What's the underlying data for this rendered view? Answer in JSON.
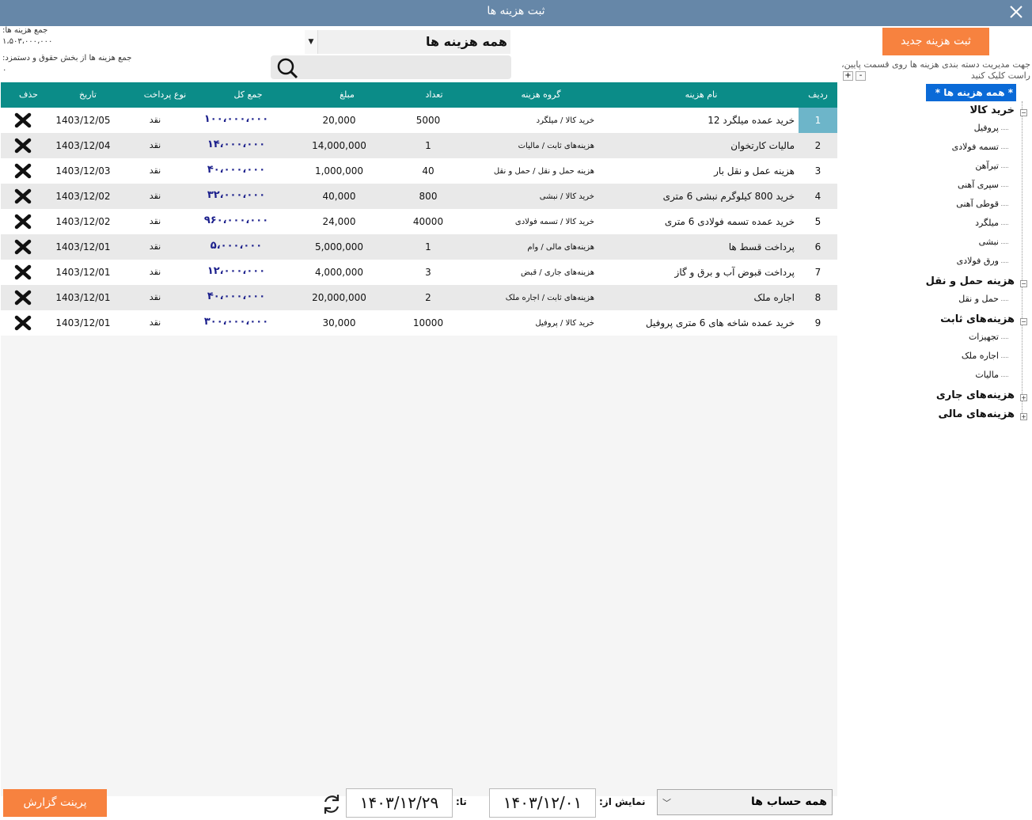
{
  "window": {
    "title": "ثبت هزینه ها"
  },
  "totals": {
    "label1": "جمع هزینه ها:",
    "value1": "۱،۵۰۳،۰۰۰،۰۰۰",
    "label2": "جمع هزینه ها از بخش حقوق و دستمزد:",
    "value2": "۰"
  },
  "filter": {
    "selected": "همه هزینه ها"
  },
  "search": {
    "placeholder": "",
    "value": ""
  },
  "table": {
    "headers": {
      "idx": "ردیف",
      "name": "نام هزینه",
      "group": "گروه هزینه",
      "qty": "تعداد",
      "amount": "مبلغ",
      "total": "جمع کل",
      "type": "نوع پرداخت",
      "date": "تاریخ",
      "del": "حذف"
    },
    "rows": [
      {
        "idx": "1",
        "name": "خرید عمده میلگرد 12",
        "group": "خرید کالا / میلگرد",
        "qty": "5000",
        "amount": "20,000",
        "total": "۱۰۰،۰۰۰،۰۰۰",
        "type": "نقد",
        "date": "1403/12/05"
      },
      {
        "idx": "2",
        "name": "مالیات کارتخوان",
        "group": "هزینه‌های ثابت / مالیات",
        "qty": "1",
        "amount": "14,000,000",
        "total": "۱۴،۰۰۰،۰۰۰",
        "type": "نقد",
        "date": "1403/12/04"
      },
      {
        "idx": "3",
        "name": "هزینه عمل و نقل بار",
        "group": "هزینه حمل و نقل / حمل و نقل",
        "qty": "40",
        "amount": "1,000,000",
        "total": "۴۰،۰۰۰،۰۰۰",
        "type": "نقد",
        "date": "1403/12/03"
      },
      {
        "idx": "4",
        "name": "خرید 800 کیلوگرم نبشی 6 متری",
        "group": "خرید کالا / نبشی",
        "qty": "800",
        "amount": "40,000",
        "total": "۳۲،۰۰۰،۰۰۰",
        "type": "نقد",
        "date": "1403/12/02"
      },
      {
        "idx": "5",
        "name": "خرید عمده تسمه فولادی 6 متری",
        "group": "خرید کالا / تسمه فولادی",
        "qty": "40000",
        "amount": "24,000",
        "total": "۹۶۰،۰۰۰،۰۰۰",
        "type": "نقد",
        "date": "1403/12/02"
      },
      {
        "idx": "6",
        "name": "پرداخت قسط ها",
        "group": "هزینه‌های مالی / وام",
        "qty": "1",
        "amount": "5,000,000",
        "total": "۵،۰۰۰،۰۰۰",
        "type": "نقد",
        "date": "1403/12/01"
      },
      {
        "idx": "7",
        "name": "پرداخت قبوض آب و برق و گاز",
        "group": "هزینه‌های جاری / قبض",
        "qty": "3",
        "amount": "4,000,000",
        "total": "۱۲،۰۰۰،۰۰۰",
        "type": "نقد",
        "date": "1403/12/01"
      },
      {
        "idx": "8",
        "name": "اجاره ملک",
        "group": "هزینه‌های ثابت / اجاره ملک",
        "qty": "2",
        "amount": "20,000,000",
        "total": "۴۰،۰۰۰،۰۰۰",
        "type": "نقد",
        "date": "1403/12/01"
      },
      {
        "idx": "9",
        "name": "خرید عمده شاخه های 6 متری پروفیل",
        "group": "خرید کالا / پروفیل",
        "qty": "10000",
        "amount": "30,000",
        "total": "۳۰۰،۰۰۰،۰۰۰",
        "type": "نقد",
        "date": "1403/12/01"
      }
    ]
  },
  "bottom": {
    "print_label": "پرینت گزارش",
    "to_label": "تا:",
    "to_date": "۱۴۰۳/۱۲/۲۹",
    "from_label": "نمایش از:",
    "from_date": "۱۴۰۳/۱۲/۰۱",
    "account_selected": "همه حساب ها"
  },
  "right": {
    "new_label": "ثبت هزینه جدید",
    "hint": "جهت مدیریت دسته بندی هزینه ها روی قسمت پایین، راست کلیک کنید",
    "plus": "+",
    "minus": "-",
    "root": "* همه هزینه ها *",
    "tree": [
      {
        "label": "خرید کالا",
        "expanded": true,
        "children": [
          "پروفیل",
          "تسمه فولادی",
          "تیرآهن",
          "سپری آهنی",
          "قوطی آهنی",
          "میلگرد",
          "نبشی",
          "ورق فولادی"
        ]
      },
      {
        "label": "هزینه حمل و نقل",
        "expanded": true,
        "children": [
          "حمل و نقل"
        ]
      },
      {
        "label": "هزینه‌های ثابت",
        "expanded": true,
        "children": [
          "تجهیزات",
          "اجاره ملک",
          "مالیات"
        ]
      },
      {
        "label": "هزینه‌های جاری",
        "expanded": false,
        "children": []
      },
      {
        "label": "هزینه‌های مالی",
        "expanded": false,
        "children": []
      }
    ]
  },
  "colors": {
    "titlebar": "#6687a8",
    "header": "#0b8c88",
    "accent": "#f7823f",
    "selected": "#0a6ad7",
    "total_text": "#1b1f8c"
  }
}
